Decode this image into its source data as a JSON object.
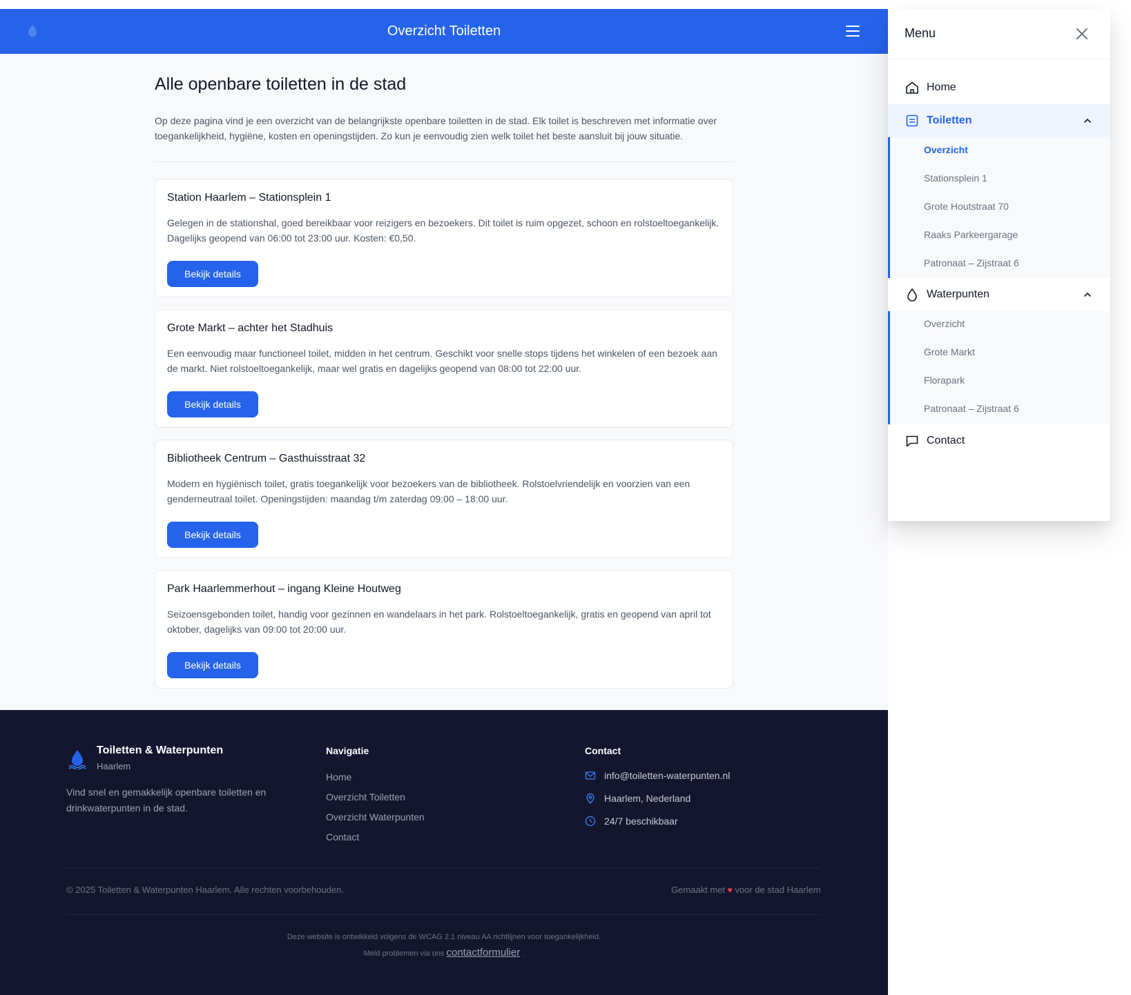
{
  "header": {
    "title": "Overzicht Toiletten",
    "menu_icon": "hamburger-icon",
    "logo_icon": "water-drop-icon"
  },
  "main": {
    "title": "Alle openbare toiletten in de stad",
    "intro": "Op deze pagina vind je een overzicht van de belangrijkste openbare toiletten in de stad. Elk toilet is beschreven met informatie over toegankelijkheid, hygiëne, kosten en openingstijden. Zo kun je eenvoudig zien welk toilet het beste aansluit bij jouw situatie.",
    "cards": [
      {
        "title": "Station Haarlem – Stationsplein 1",
        "text": "Gelegen in de stationshal, goed bereikbaar voor reizigers en bezoekers. Dit toilet is ruim opgezet, schoon en rolstoeltoegankelijk. Dagelijks geopend van 06:00 tot 23:00 uur. Kosten: €0,50.",
        "button": "Bekijk details"
      },
      {
        "title": "Grote Markt – achter het Stadhuis",
        "text": "Een eenvoudig maar functioneel toilet, midden in het centrum. Geschikt voor snelle stops tijdens het winkelen of een bezoek aan de markt. Niet rolstoeltoegankelijk, maar wel gratis en dagelijks geopend van 08:00 tot 22:00 uur.",
        "button": "Bekijk details"
      },
      {
        "title": "Bibliotheek Centrum – Gasthuisstraat 32",
        "text": "Modern en hygiënisch toilet, gratis toegankelijk voor bezoekers van de bibliotheek. Rolstoelvriendelijk en voorzien van een genderneutraal toilet. Openingstijden: maandag t/m zaterdag 09:00 – 18:00 uur.",
        "button": "Bekijk details"
      },
      {
        "title": "Park Haarlemmerhout – ingang Kleine Houtweg",
        "text": "Seizoensgebonden toilet, handig voor gezinnen en wandelaars in het park. Rolstoeltoegankelijk, gratis en geopend van april tot oktober, dagelijks van 09:00 tot 20:00 uur.",
        "button": "Bekijk details"
      }
    ]
  },
  "footer": {
    "brand_name": "Toiletten & Waterpunten",
    "brand_city": "Haarlem",
    "description": "Vind snel en gemakkelijk openbare toiletten en drinkwaterpunten in de stad.",
    "nav_title": "Navigatie",
    "nav_links": [
      "Home",
      "Overzicht Toiletten",
      "Overzicht Waterpunten",
      "Contact"
    ],
    "contact_title": "Contact",
    "contact_email": "info@toiletten-waterpunten.nl",
    "contact_location": "Haarlem, Nederland",
    "contact_hours": "24/7 beschikbaar",
    "copyright": "© 2025 Toiletten & Waterpunten Haarlem. Alle rechten voorbehouden.",
    "made_prefix": "Gemaakt met",
    "made_heart": "♥",
    "made_suffix": "voor de stad Haarlem",
    "wcag": "Deze website is ontwikkeld volgens de WCAG 2.1 niveau AA richtlijnen voor toegankelijkheid.",
    "report_prefix": "Meld problemen via ons",
    "report_link": "contactformulier",
    "report_suffix": "."
  },
  "drawer": {
    "title": "Menu",
    "items": {
      "home": "Home",
      "toiletten": "Toiletten",
      "waterpunten": "Waterpunten",
      "contact": "Contact"
    },
    "toiletten_sub": [
      "Overzicht",
      "Stationsplein 1",
      "Grote Houtstraat 70",
      "Raaks Parkeergarage",
      "Patronaat – Zijstraat 6"
    ],
    "waterpunten_sub": [
      "Overzicht",
      "Grote Markt",
      "Florapark",
      "Patronaat – Zijstraat 6"
    ]
  },
  "colors": {
    "primary": "#2563eb",
    "footer_bg": "#141630",
    "page_bg": "#f8f9fb",
    "heart": "#ef4444"
  }
}
